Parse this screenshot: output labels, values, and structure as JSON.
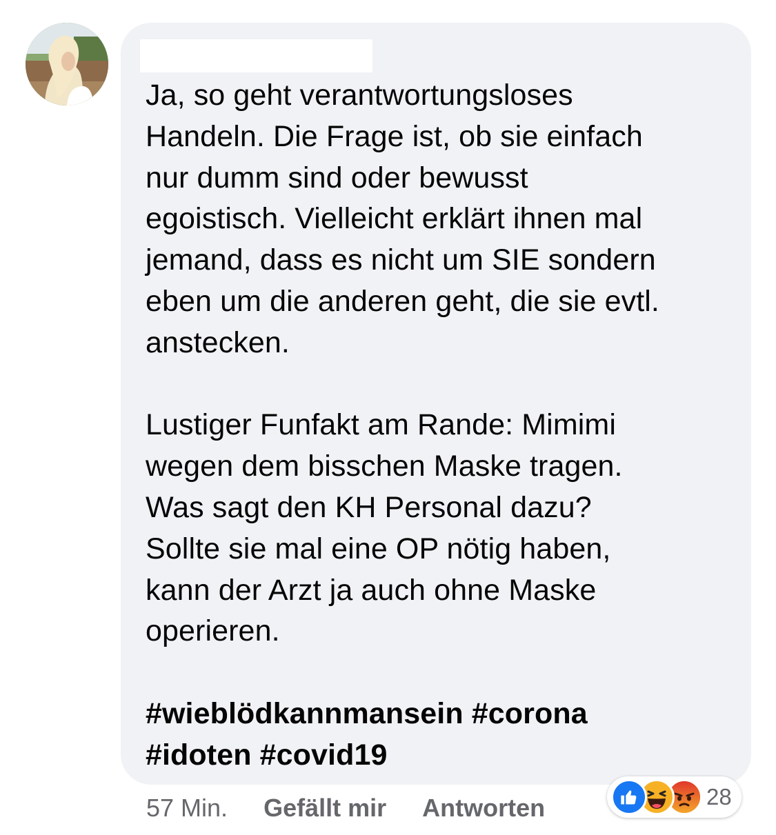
{
  "avatar": {
    "icon": "user-avatar-photo"
  },
  "comment": {
    "author_name": "",
    "paragraphs": [
      "Ja, so geht verantwortungsloses\nHandeln. Die Frage ist, ob sie einfach\nnur dumm sind oder bewusst\negoistisch. Vielleicht erklärt ihnen mal\njemand, dass es nicht um SIE sondern\neben um die anderen geht, die sie evtl.\nanstecken.",
      "Lustiger Funfakt am Rande: Mimimi\nwegen dem bisschen Maske tragen.\nWas sagt den KH Personal dazu?\nSollte sie mal eine OP nötig haben,\nkann der Arzt ja auch ohne Maske\noperieren."
    ],
    "hashtags": "#wieblödkannmansein #corona\n#idoten #covid19"
  },
  "meta": {
    "time": "57 Min.",
    "like_label": "Gefällt mir",
    "reply_label": "Antworten"
  },
  "reactions": {
    "icons": [
      "like-icon",
      "haha-icon",
      "angry-icon"
    ],
    "count": "28",
    "colors": {
      "like": "#1877f2",
      "haha": "#f7b125",
      "angry": "#e9710f"
    }
  },
  "colors": {
    "bubble_bg": "#f0f2f5",
    "text": "#050505",
    "secondary_text": "#65676b"
  }
}
